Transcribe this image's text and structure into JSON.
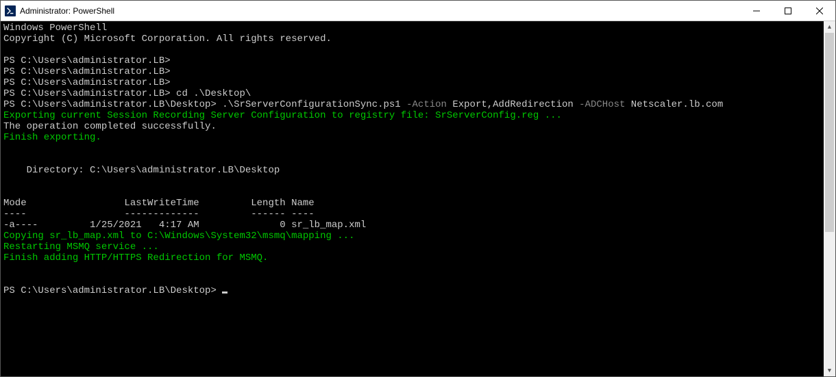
{
  "window": {
    "title": "Administrator: PowerShell"
  },
  "terminal": {
    "header1": "Windows PowerShell",
    "header2": "Copyright (C) Microsoft Corporation. All rights reserved.",
    "prompt1": "PS C:\\Users\\administrator.LB>",
    "prompt2": "PS C:\\Users\\administrator.LB>",
    "prompt3": "PS C:\\Users\\administrator.LB>",
    "prompt4_ps": "PS C:\\Users\\administrator.LB> ",
    "prompt4_cmd": "cd .\\Desktop\\",
    "prompt5_ps": "PS C:\\Users\\administrator.LB\\Desktop> ",
    "prompt5_script": ".\\SrServerConfigurationSync.ps1",
    "prompt5_param1": " -Action",
    "prompt5_val1": " Export,AddRedirection",
    "prompt5_param2": " -ADCHost",
    "prompt5_val2": " Netscaler.lb.com",
    "out1": "Exporting current Session Recording Server Configuration to registry file: SrServerConfig.reg ...",
    "out2": "The operation completed successfully.",
    "out3": "Finish exporting.",
    "dir_header": "    Directory: C:\\Users\\administrator.LB\\Desktop",
    "tbl_header": "Mode                 LastWriteTime         Length Name",
    "tbl_sep": "----                 -------------         ------ ----",
    "tbl_row": "-a----         1/25/2021   4:17 AM              0 sr_lb_map.xml",
    "out4": "Copying sr_lb_map.xml to C:\\Windows\\System32\\msmq\\mapping ...",
    "out5": "Restarting MSMQ service ...",
    "out6": "Finish adding HTTP/HTTPS Redirection for MSMQ.",
    "prompt_final": "PS C:\\Users\\administrator.LB\\Desktop> "
  }
}
